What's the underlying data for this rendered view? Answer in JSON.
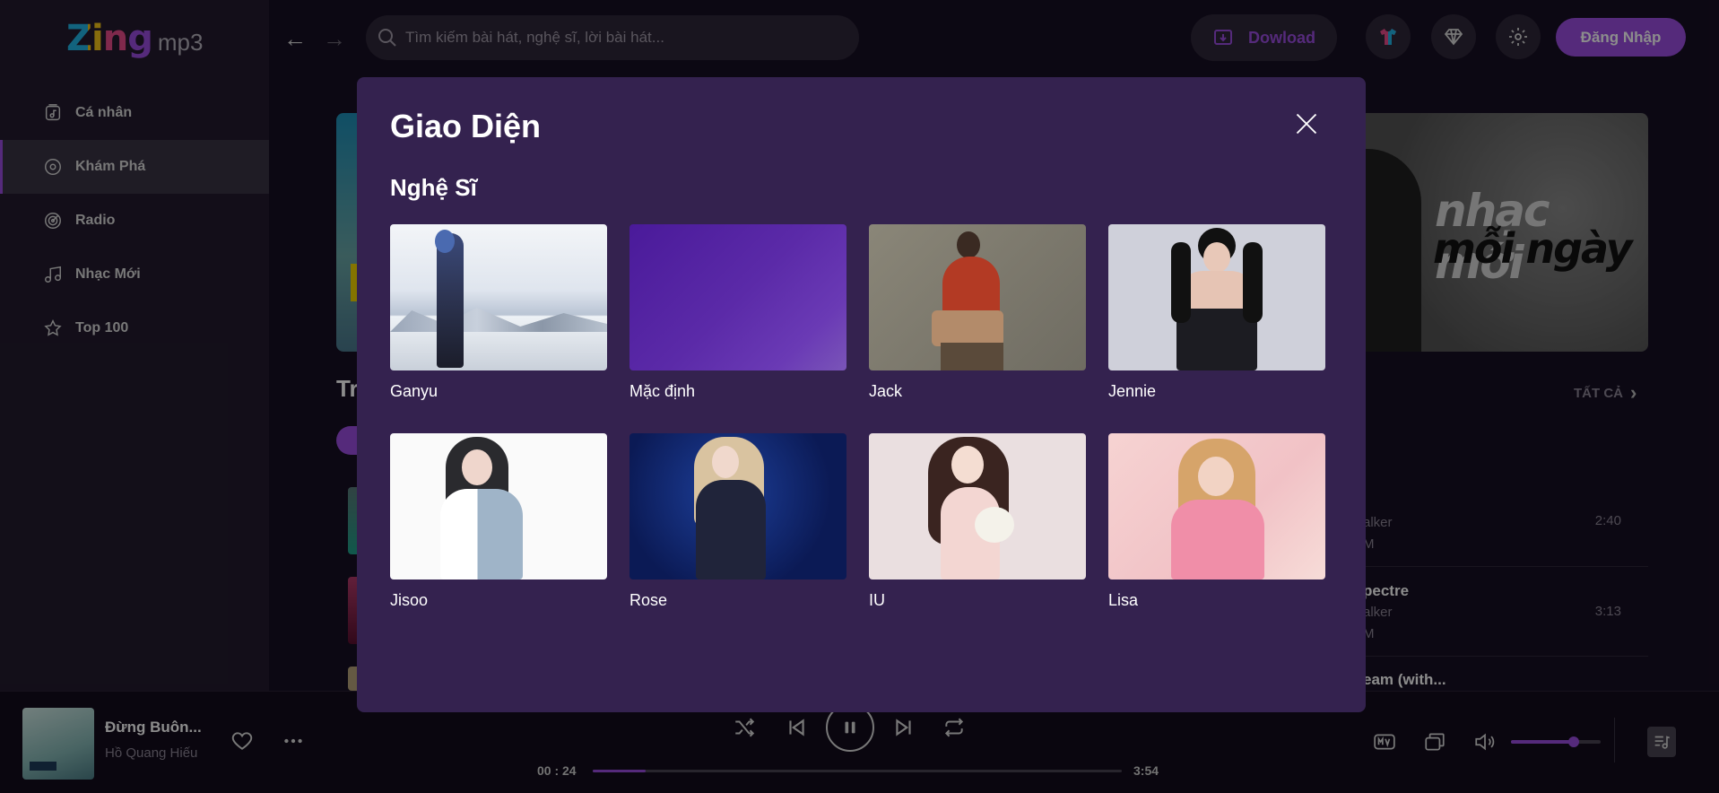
{
  "app": {
    "logo_main": "Zing",
    "logo_sub": "mp3"
  },
  "sidebar": {
    "items": [
      {
        "label": "Cá nhân",
        "icon": "music-library-icon"
      },
      {
        "label": "Khám Phá",
        "icon": "disc-icon",
        "active": true
      },
      {
        "label": "Radio",
        "icon": "radio-icon"
      },
      {
        "label": "Nhạc Mới",
        "icon": "music-note-icon"
      },
      {
        "label": "Top 100",
        "icon": "star-icon"
      }
    ]
  },
  "header": {
    "search_placeholder": "Tìm kiếm bài hát, nghệ sĩ, lời bài hát...",
    "download_label": "Dowload",
    "login_label": "Đăng Nhập"
  },
  "background": {
    "banner_text_1": "nhạc mới",
    "banner_text_2": "mỗi ngày",
    "section_fragment": "Tr",
    "see_all": "TẤT CẢ",
    "songs": [
      {
        "title": "",
        "artist": "alker",
        "sub": "M",
        "duration": "2:40"
      },
      {
        "title": "pectre",
        "artist": "alker",
        "sub": "M",
        "duration": "3:13"
      },
      {
        "title": "eam (with...",
        "artist": "",
        "sub": "",
        "duration": ""
      }
    ]
  },
  "modal": {
    "title": "Giao Diện",
    "section": "Nghệ Sĩ",
    "themes": [
      {
        "name": "Ganyu"
      },
      {
        "name": "Mặc định"
      },
      {
        "name": "Jack"
      },
      {
        "name": "Jennie"
      },
      {
        "name": "Jisoo"
      },
      {
        "name": "Rose"
      },
      {
        "name": "IU"
      },
      {
        "name": "Lisa"
      }
    ]
  },
  "player": {
    "song_title": "Đừng Buôn...",
    "artist": "Hồ Quang Hiếu",
    "current_time": "00 : 24",
    "total_time": "3:54",
    "progress": 0.1,
    "volume": 0.7
  },
  "colors": {
    "accent": "#9b4de0",
    "background": "#170f23",
    "sidebar": "#231b2e",
    "modal": "#34224f"
  }
}
